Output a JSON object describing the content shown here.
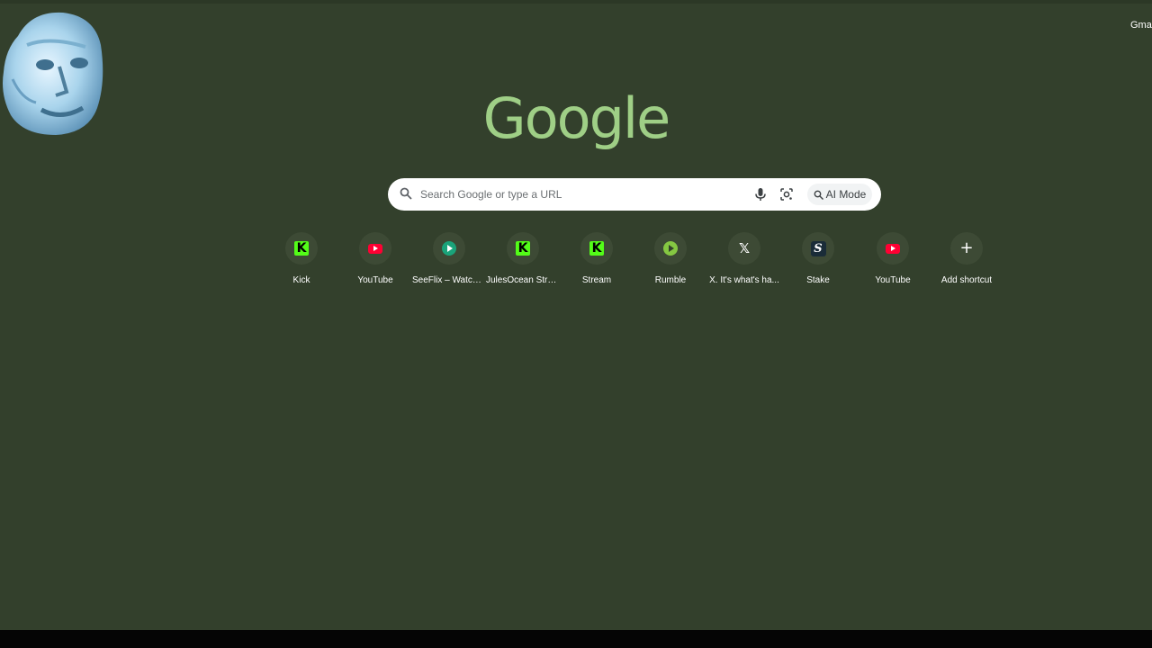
{
  "header": {
    "gmail_label": "Gmail"
  },
  "logo": {
    "text": "Google",
    "color": "#9fcf86"
  },
  "search": {
    "placeholder": "Search Google or type a URL",
    "ai_mode_label": "AI Mode"
  },
  "shortcuts": [
    {
      "label": "Kick",
      "icon": "kick-icon"
    },
    {
      "label": "YouTube",
      "icon": "youtube-icon"
    },
    {
      "label": "SeeFlix – Watch ...",
      "icon": "seeflix-icon"
    },
    {
      "label": "JulesOcean Stre...",
      "icon": "kick-icon"
    },
    {
      "label": "Stream",
      "icon": "kick-icon"
    },
    {
      "label": "Rumble",
      "icon": "rumble-icon"
    },
    {
      "label": "X. It's what's ha...",
      "icon": "x-icon"
    },
    {
      "label": "Stake",
      "icon": "stake-icon"
    },
    {
      "label": "YouTube",
      "icon": "youtube-icon"
    },
    {
      "label": "Add shortcut",
      "icon": "plus-icon"
    }
  ],
  "icon_glyphs": {
    "kick": "K",
    "x": "𝕏",
    "stake": "S",
    "plus": "+"
  },
  "colors": {
    "background": "#33402c",
    "kick": "#53fc18",
    "youtube": "#ff0033",
    "rumble": "#85c742"
  }
}
